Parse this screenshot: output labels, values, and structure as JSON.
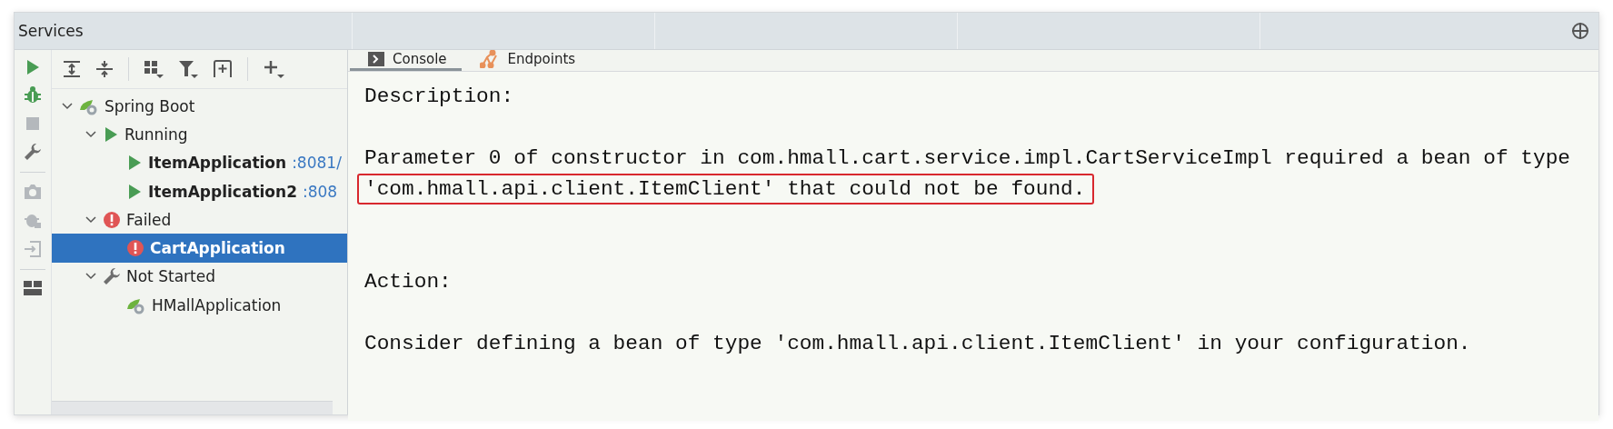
{
  "window": {
    "title": "Services"
  },
  "side_strip": [
    {
      "kind": "run",
      "disabled": false
    },
    {
      "kind": "debug",
      "disabled": false
    },
    {
      "kind": "stop",
      "disabled": true
    },
    {
      "kind": "wrench",
      "disabled": false
    },
    {
      "kind": "camera",
      "disabled": true
    },
    {
      "kind": "debug-alt",
      "disabled": true
    },
    {
      "kind": "import",
      "disabled": true
    },
    {
      "kind": "layout",
      "disabled": false
    }
  ],
  "toolbar": [
    {
      "kind": "expand-all"
    },
    {
      "kind": "collapse-all"
    },
    {
      "kind": "group"
    },
    {
      "kind": "filter"
    },
    {
      "kind": "new-tab"
    },
    {
      "kind": "add"
    }
  ],
  "tree": [
    {
      "label": "Spring Boot",
      "kind": "spring",
      "expanded": true,
      "bold": false,
      "selected": false,
      "children": [
        {
          "label": "Running",
          "kind": "run",
          "expanded": true,
          "bold": false,
          "selected": false,
          "children": [
            {
              "label": "ItemApplication",
              "port": ":8081/",
              "kind": "run",
              "bold": true,
              "selected": false
            },
            {
              "label": "ItemApplication2",
              "port": ":808",
              "kind": "run",
              "bold": true,
              "selected": false
            }
          ]
        },
        {
          "label": "Failed",
          "kind": "error",
          "expanded": true,
          "bold": false,
          "selected": false,
          "children": [
            {
              "label": "CartApplication",
              "kind": "error",
              "bold": true,
              "selected": true
            }
          ]
        },
        {
          "label": "Not Started",
          "kind": "wrench",
          "expanded": true,
          "bold": false,
          "selected": false,
          "children": [
            {
              "label": "HMallApplication",
              "kind": "spring",
              "bold": false,
              "selected": false
            }
          ]
        }
      ]
    }
  ],
  "tabs": [
    {
      "label": "Console",
      "kind": "console",
      "selected": true
    },
    {
      "label": "Endpoints",
      "kind": "endpoints",
      "selected": false
    }
  ],
  "console": [
    {
      "heading": "Description:",
      "lines": [
        {
          "text": "Parameter 0 of constructor in com.hmall.cart.service.impl.CartServiceImpl required a bean of type",
          "highlighted": false
        },
        {
          "text": "'com.hmall.api.client.ItemClient' that could not be found.",
          "highlighted": true
        }
      ]
    },
    {
      "heading": "Action:",
      "lines": [
        {
          "text": "Consider defining a bean of type 'com.hmall.api.client.ItemClient' in your configuration.",
          "highlighted": false
        }
      ]
    }
  ]
}
